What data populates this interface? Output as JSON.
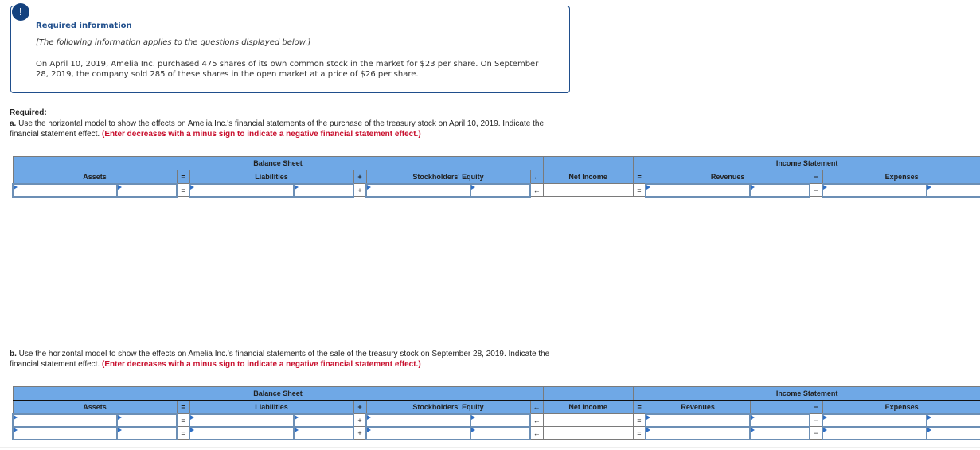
{
  "info": {
    "badge_icon": "!",
    "title": "Required information",
    "note": "[The following information applies to the questions displayed below.]",
    "body": "On April 10, 2019, Amelia Inc. purchased 475 shares of its own common stock in the market for $23 per share. On September 28, 2019, the company sold 285 of these shares in the open market at a price of $26 per share."
  },
  "required_label": "Required:",
  "part_a": {
    "lead": "a.",
    "text": " Use the horizontal model to show the effects on Amelia Inc.'s financial statements of the purchase of the treasury stock on April 10, 2019. Indicate the financial statement effect. ",
    "instruction": "(Enter decreases with a minus sign to indicate a negative financial statement effect.)"
  },
  "part_b": {
    "lead": "b.",
    "text": " Use the horizontal model to show the effects on Amelia Inc.'s financial statements of the sale of the treasury stock on September 28, 2019. Indicate the financial statement effect. ",
    "instruction": "(Enter decreases with a minus sign to indicate a negative financial statement effect.)"
  },
  "table": {
    "balance_sheet": "Balance Sheet",
    "income_statement": "Income Statement",
    "assets": "Assets",
    "liabilities": "Liabilities",
    "equity": "Stockholders' Equity",
    "net_income": "Net Income",
    "revenues": "Revenues",
    "expenses": "Expenses",
    "op_equals": "=",
    "op_plus": "+",
    "op_arrow": "←",
    "op_minus": "−"
  },
  "table_a_rows": [
    {
      "assets_1": "",
      "assets_2": "",
      "liab_1": "",
      "liab_2": "",
      "eq_1": "",
      "eq_2": "",
      "net_income": "",
      "rev_1": "",
      "rev_2": "",
      "exp_1": "",
      "exp_2": ""
    }
  ],
  "table_b_rows": [
    {
      "assets_1": "",
      "assets_2": "",
      "liab_1": "",
      "liab_2": "",
      "eq_1": "",
      "eq_2": "",
      "net_income": "",
      "rev_1": "",
      "rev_2": "",
      "exp_1": "",
      "exp_2": ""
    },
    {
      "assets_1": "",
      "assets_2": "",
      "liab_1": "",
      "liab_2": "",
      "eq_1": "",
      "eq_2": "",
      "net_income": "",
      "rev_1": "",
      "rev_2": "",
      "exp_1": "",
      "exp_2": ""
    }
  ],
  "colors": {
    "header_blue": "#6fa8e6",
    "info_navy": "#14427f",
    "instruction_red": "#c8102e",
    "input_flag_blue": "#2f6fc4"
  }
}
